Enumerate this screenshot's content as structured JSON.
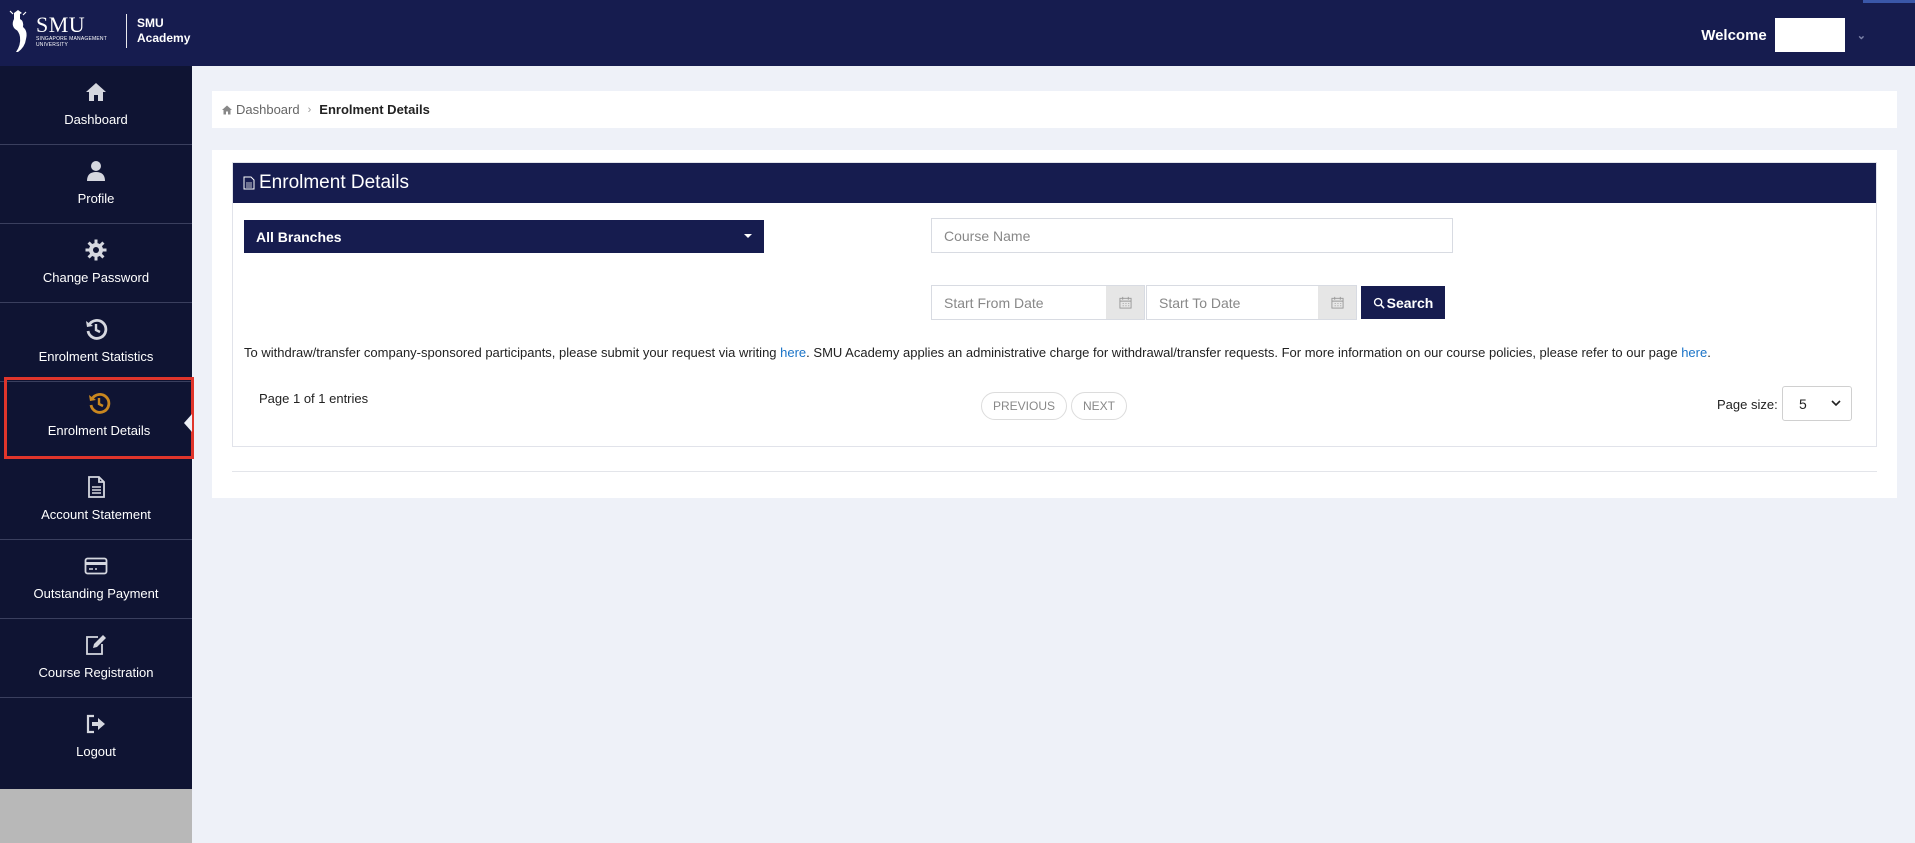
{
  "header": {
    "logo_text": "SMU",
    "logo_subtext": "SINGAPORE MANAGEMENT UNIVERSITY",
    "logo_academy_line1": "SMU",
    "logo_academy_line2": "Academy",
    "welcome_label": "Welcome"
  },
  "sidebar": {
    "items": [
      {
        "label": "Dashboard",
        "icon": "home-icon"
      },
      {
        "label": "Profile",
        "icon": "user-icon"
      },
      {
        "label": "Change Password",
        "icon": "gear-icon"
      },
      {
        "label": "Enrolment Statistics",
        "icon": "history-icon"
      },
      {
        "label": "Enrolment Details",
        "icon": "history-icon",
        "active": true
      },
      {
        "label": "Account Statement",
        "icon": "document-icon"
      },
      {
        "label": "Outstanding Payment",
        "icon": "credit-card-icon"
      },
      {
        "label": "Course Registration",
        "icon": "edit-icon"
      },
      {
        "label": "Logout",
        "icon": "logout-icon"
      }
    ],
    "active_icon_color": "#c9871f",
    "active_border_color": "#e0352b"
  },
  "breadcrumb": {
    "home": "Dashboard",
    "current": "Enrolment Details"
  },
  "panel": {
    "title": "Enrolment Details",
    "branch_select": "All Branches",
    "course_name_placeholder": "Course Name",
    "start_from_placeholder": "Start From Date",
    "start_to_placeholder": "Start To Date",
    "search_label": "Search",
    "notice_part1": "To withdraw/transfer company-sponsored participants, please submit your request via writing ",
    "notice_link1": "here",
    "notice_part2": ". SMU Academy applies an administrative charge for withdrawal/transfer requests. For more information on our course policies, please refer to our page ",
    "notice_link2": "here",
    "notice_part3": ".",
    "page_info": "Page 1 of 1 entries",
    "previous_label": "PREVIOUS",
    "next_label": "NEXT",
    "page_size_label": "Page size:",
    "page_size_value": "5"
  },
  "colors": {
    "navy": "#161c4f",
    "sidebar": "#0f1433",
    "link": "#1a73c7"
  }
}
